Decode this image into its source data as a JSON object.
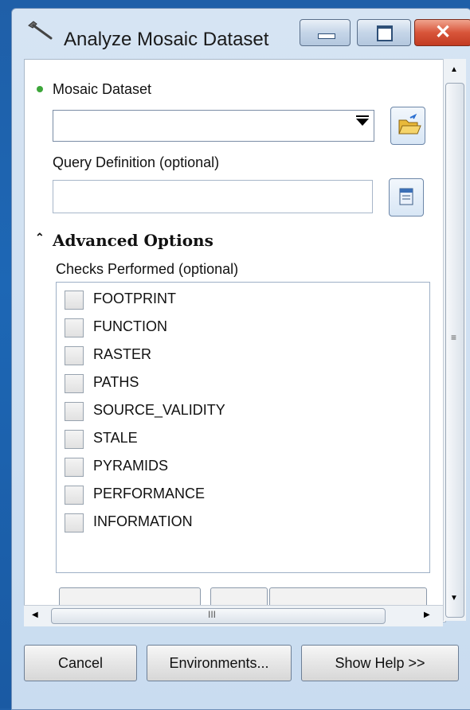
{
  "window": {
    "title": "Analyze Mosaic Dataset"
  },
  "form": {
    "mosaic_dataset": {
      "label": "Mosaic Dataset",
      "value": ""
    },
    "query_definition": {
      "label": "Query Definition (optional)",
      "value": ""
    },
    "advanced_options": {
      "label": "Advanced Options",
      "expanded": true
    },
    "checks": {
      "label": "Checks Performed (optional)",
      "items": [
        {
          "label": "FOOTPRINT",
          "checked": false
        },
        {
          "label": "FUNCTION",
          "checked": false
        },
        {
          "label": "RASTER",
          "checked": false
        },
        {
          "label": "PATHS",
          "checked": false
        },
        {
          "label": "SOURCE_VALIDITY",
          "checked": false
        },
        {
          "label": "STALE",
          "checked": false
        },
        {
          "label": "PYRAMIDS",
          "checked": false
        },
        {
          "label": "PERFORMANCE",
          "checked": false
        },
        {
          "label": "INFORMATION",
          "checked": false
        }
      ]
    }
  },
  "buttons": {
    "cancel": "Cancel",
    "environments": "Environments...",
    "show_help": "Show Help >>"
  },
  "scroll": {
    "h_grip": "III",
    "v_grip": "≡"
  },
  "colors": {
    "required_dot": "#3da63a",
    "window_frame": "#c9dcf0",
    "close_button": "#c23b22"
  }
}
